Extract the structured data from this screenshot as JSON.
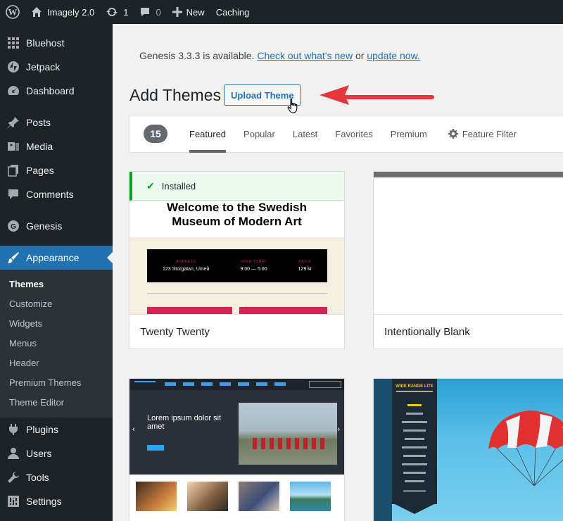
{
  "adminbar": {
    "site_name": "Imagely 2.0",
    "updates_count": "1",
    "comments_count": "0",
    "new_label": "New",
    "caching_label": "Caching"
  },
  "sidebar": {
    "items_top": [
      {
        "label": "Bluehost",
        "icon": "grid-icon"
      },
      {
        "label": "Jetpack",
        "icon": "jetpack-icon"
      },
      {
        "label": "Dashboard",
        "icon": "dashboard-icon"
      }
    ],
    "items_mid": [
      {
        "label": "Posts",
        "icon": "pin-icon"
      },
      {
        "label": "Media",
        "icon": "media-icon"
      },
      {
        "label": "Pages",
        "icon": "pages-icon"
      },
      {
        "label": "Comments",
        "icon": "comments-icon"
      }
    ],
    "genesis": {
      "label": "Genesis",
      "icon": "genesis-icon"
    },
    "appearance": {
      "label": "Appearance",
      "icon": "brush-icon"
    },
    "submenu": [
      "Themes",
      "Customize",
      "Widgets",
      "Menus",
      "Header",
      "Premium Themes",
      "Theme Editor"
    ],
    "items_bottom": [
      {
        "label": "Plugins",
        "icon": "plugin-icon"
      },
      {
        "label": "Users",
        "icon": "users-icon"
      },
      {
        "label": "Tools",
        "icon": "wrench-icon"
      },
      {
        "label": "Settings",
        "icon": "settings-icon"
      }
    ]
  },
  "notice": {
    "prefix": "Genesis 3.3.3 is available. ",
    "link1": "Check out what's new",
    "middle": " or ",
    "link2": "update now."
  },
  "page": {
    "title": "Add Themes",
    "upload_button": "Upload Theme"
  },
  "filter": {
    "count": "15",
    "tabs": [
      "Featured",
      "Popular",
      "Latest",
      "Favorites",
      "Premium"
    ],
    "feature_filter": "Feature Filter"
  },
  "themes": [
    {
      "name": "Twenty Twenty",
      "installed_label": "Installed",
      "hero_text": "Welcome to the Swedish Museum of Modern Art",
      "panel": [
        {
          "label": "ADDRESS",
          "value": "123 Storgatan, Umeå"
        },
        {
          "label": "OPEN TODAY",
          "value": "9:00 — 5:00"
        },
        {
          "label": "PRICE",
          "value": "129 kr"
        }
      ]
    },
    {
      "name": "Intentionally Blank"
    },
    {
      "name": "",
      "preview_title": "Lorem ipsum dolor sit amet"
    },
    {
      "name": "",
      "preview_title": "WIDE RANGE LITE"
    }
  ],
  "colors": {
    "admin_dark": "#1d2327",
    "accent": "#2271b1",
    "installed_green": "#00a32a",
    "arrow_red": "#e8343b"
  }
}
